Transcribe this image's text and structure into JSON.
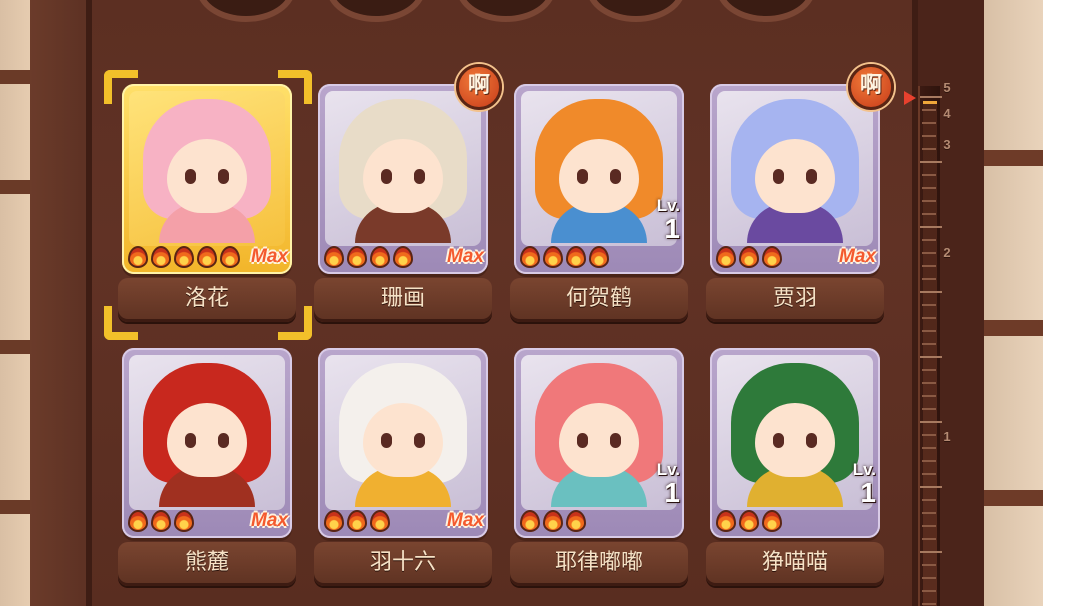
{
  "gauge": {
    "labels": [
      "5",
      "4",
      "3",
      "2",
      "1"
    ],
    "level": 4.5
  },
  "cards": [
    {
      "name": "洛花",
      "flames": 5,
      "status": "max",
      "max_label": "Max",
      "badge": null,
      "selected": true,
      "theme": "gold",
      "hair": "#f7b2c4",
      "outfit": "#f4a0a8"
    },
    {
      "name": "珊画",
      "flames": 4,
      "status": "max",
      "max_label": "Max",
      "badge": "啊",
      "selected": false,
      "theme": "purple",
      "hair": "#e8dcc8",
      "outfit": "#7a3a2a"
    },
    {
      "name": "何贺鹤",
      "flames": 4,
      "status": "level",
      "lv_label": "Lv.",
      "lv_value": "1",
      "badge": null,
      "selected": false,
      "theme": "purple",
      "hair": "#f08a2a",
      "outfit": "#4a8fd0"
    },
    {
      "name": "贾羽",
      "flames": 3,
      "status": "max",
      "max_label": "Max",
      "badge": "啊",
      "selected": false,
      "theme": "purple",
      "hair": "#a6b4f0",
      "outfit": "#6a4aa0"
    },
    {
      "name": "熊麓",
      "flames": 3,
      "status": "max",
      "max_label": "Max",
      "badge": null,
      "selected": false,
      "theme": "purple",
      "hair": "#c8281e",
      "outfit": "#a03020"
    },
    {
      "name": "羽十六",
      "flames": 3,
      "status": "max",
      "max_label": "Max",
      "badge": null,
      "selected": false,
      "theme": "purple",
      "hair": "#f4f0ec",
      "outfit": "#f0b030"
    },
    {
      "name": "耶律嘟嘟",
      "flames": 3,
      "status": "level",
      "lv_label": "Lv.",
      "lv_value": "1",
      "badge": null,
      "selected": false,
      "theme": "purple",
      "hair": "#f0787a",
      "outfit": "#6ac0c0"
    },
    {
      "name": "狰喵喵",
      "flames": 3,
      "status": "level",
      "lv_label": "Lv.",
      "lv_value": "1",
      "badge": null,
      "selected": false,
      "theme": "purple",
      "hair": "#2e7a3a",
      "outfit": "#e0b030"
    }
  ]
}
